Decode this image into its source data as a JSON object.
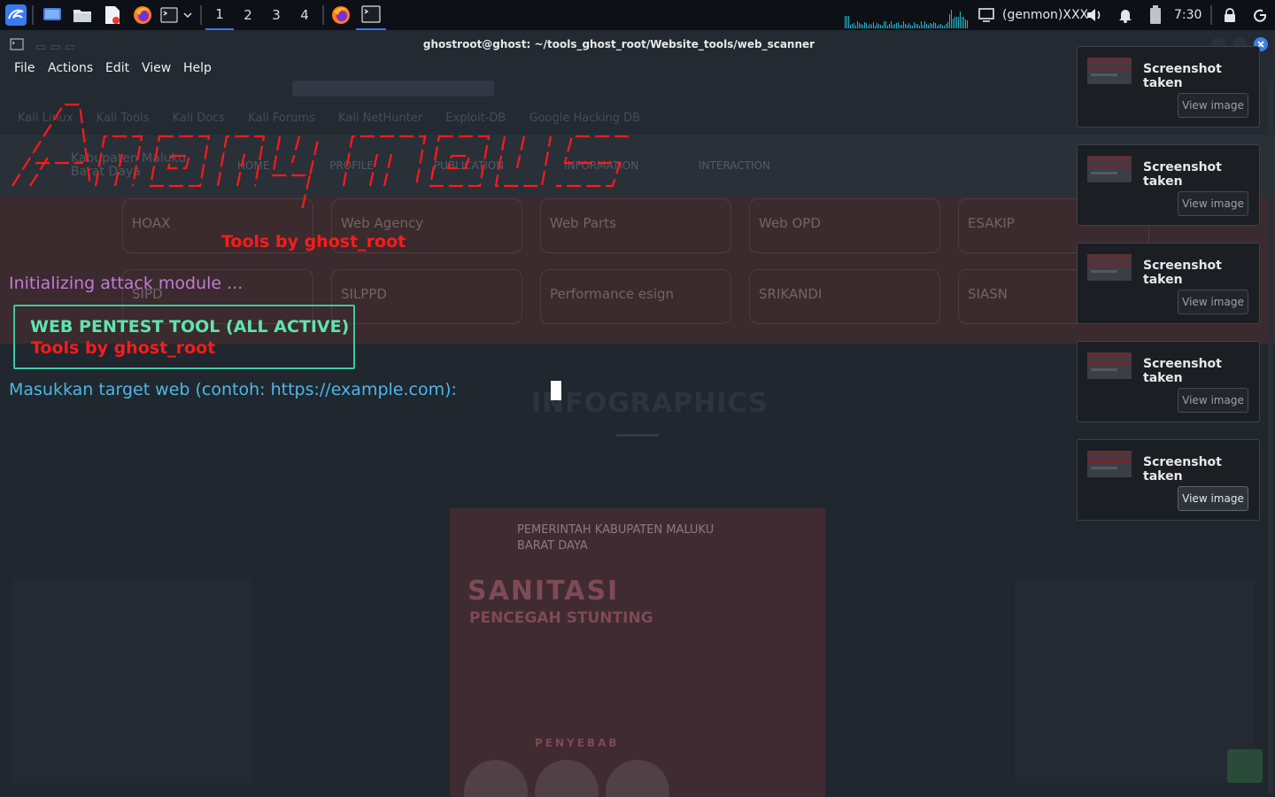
{
  "panel": {
    "workspaces": [
      "1",
      "2",
      "3",
      "4"
    ],
    "active_workspace": "1",
    "genmon": "(genmon)XXX",
    "clock": "7:30",
    "accent": "#367bf0"
  },
  "window": {
    "title": "ghostroot@ghost: ~/tools_ghost_root/Website_tools/web_scanner",
    "menu": [
      "File",
      "Actions",
      "Edit",
      "View",
      "Help"
    ]
  },
  "terminal": {
    "banner_tools_by": "Tools by ghost_root",
    "init_line": "Initializing attack module ...",
    "box_line1": "WEB PENTEST TOOL (ALL ACTIVE)",
    "box_line2": "Tools by ghost_root",
    "prompt": "Masukkan target web (contoh: https://example.com):",
    "colors": {
      "banner": "#ff1a1a",
      "init": "#c27bd4",
      "box_border": "#3cc9a0",
      "box_title": "#5ee4b4",
      "prompt": "#4cb7e6"
    }
  },
  "notifications": [
    {
      "title": "Screenshot taken",
      "button": "View image"
    },
    {
      "title": "Screenshot taken",
      "button": "View image"
    },
    {
      "title": "Screenshot taken",
      "button": "View image"
    },
    {
      "title": "Screenshot taken",
      "button": "View image"
    },
    {
      "title": "Screenshot taken",
      "button": "View image"
    }
  ],
  "background_browser": {
    "bookmarks": [
      "Kali Linux",
      "Kali Tools",
      "Kali Docs",
      "Kali Forums",
      "Kali NetHunter",
      "Exploit-DB",
      "Google Hacking DB"
    ],
    "brand": "Kabupaten Maluku Barat Daya",
    "nav": [
      "HOME",
      "PROFILE",
      "PUBLICATION",
      "INFORMATION",
      "INTERACTION"
    ],
    "cards": [
      "HOAX",
      "Web Agency",
      "Web Parts",
      "Web OPD",
      "ESAKIP",
      "SIPD",
      "SILPPD",
      "Performance esign",
      "SRIKANDI",
      "SIASN"
    ],
    "section_title": "INFOGRAPHICS",
    "poster": {
      "header": "PEMERINTAH KABUPATEN MALUKU BARAT DAYA",
      "title": "SANITASI",
      "subtitle": "PENCEGAH STUNTING",
      "penyebab": "PENYEBAB"
    }
  }
}
